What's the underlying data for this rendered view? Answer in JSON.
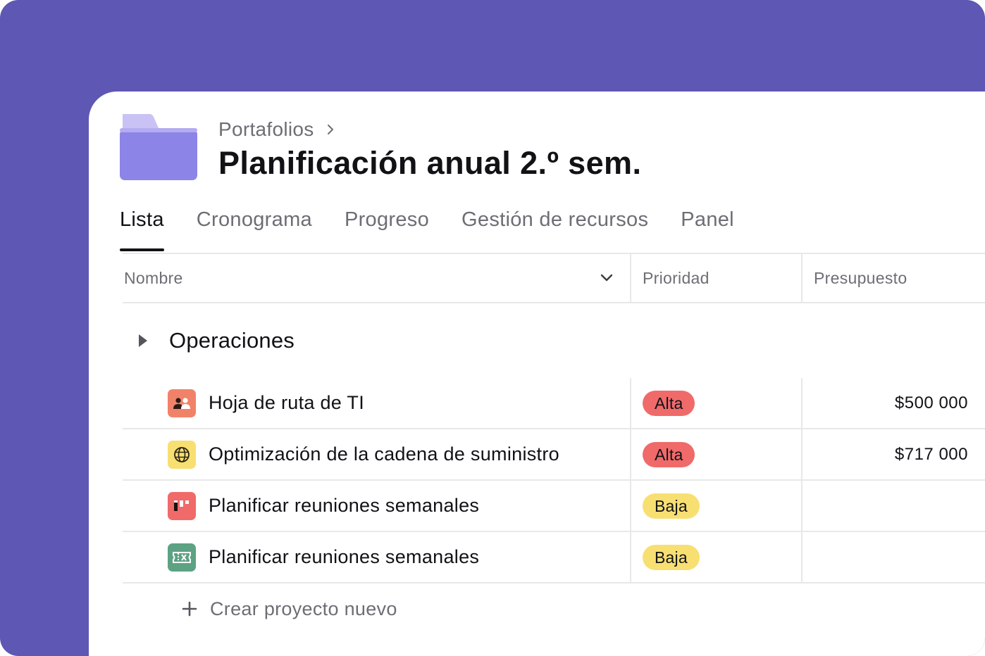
{
  "breadcrumb": {
    "parent": "Portafolios"
  },
  "page": {
    "title": "Planificación anual 2.º sem."
  },
  "tabs": [
    {
      "label": "Lista",
      "active": true
    },
    {
      "label": "Cronograma",
      "active": false
    },
    {
      "label": "Progreso",
      "active": false
    },
    {
      "label": "Gestión de recursos",
      "active": false
    },
    {
      "label": "Panel",
      "active": false
    }
  ],
  "table": {
    "columns": {
      "name": "Nombre",
      "priority": "Prioridad",
      "budget": "Presupuesto"
    },
    "section": {
      "title": "Operaciones"
    },
    "rows": [
      {
        "icon": "people-icon",
        "icon_color": "#f1826a",
        "name": "Hoja de ruta de TI",
        "priority": "Alta",
        "priority_color": "#f06a6a",
        "budget": "$500 000"
      },
      {
        "icon": "globe-icon",
        "icon_color": "#f8df72",
        "name": "Optimización de la cadena de suministro",
        "priority": "Alta",
        "priority_color": "#f06a6a",
        "budget": "$717 000"
      },
      {
        "icon": "board-icon",
        "icon_color": "#f06a6a",
        "name": "Planificar reuniones semanales",
        "priority": "Baja",
        "priority_color": "#f8df72",
        "budget": ""
      },
      {
        "icon": "ticket-icon",
        "icon_color": "#5da283",
        "name": "Planificar reuniones semanales",
        "priority": "Baja",
        "priority_color": "#f8df72",
        "budget": ""
      }
    ],
    "add_project": "Crear proyecto nuevo"
  },
  "colors": {
    "background": "#5e57b3",
    "folder": "#8d84e8",
    "folder_tab": "#c9c3f5"
  }
}
